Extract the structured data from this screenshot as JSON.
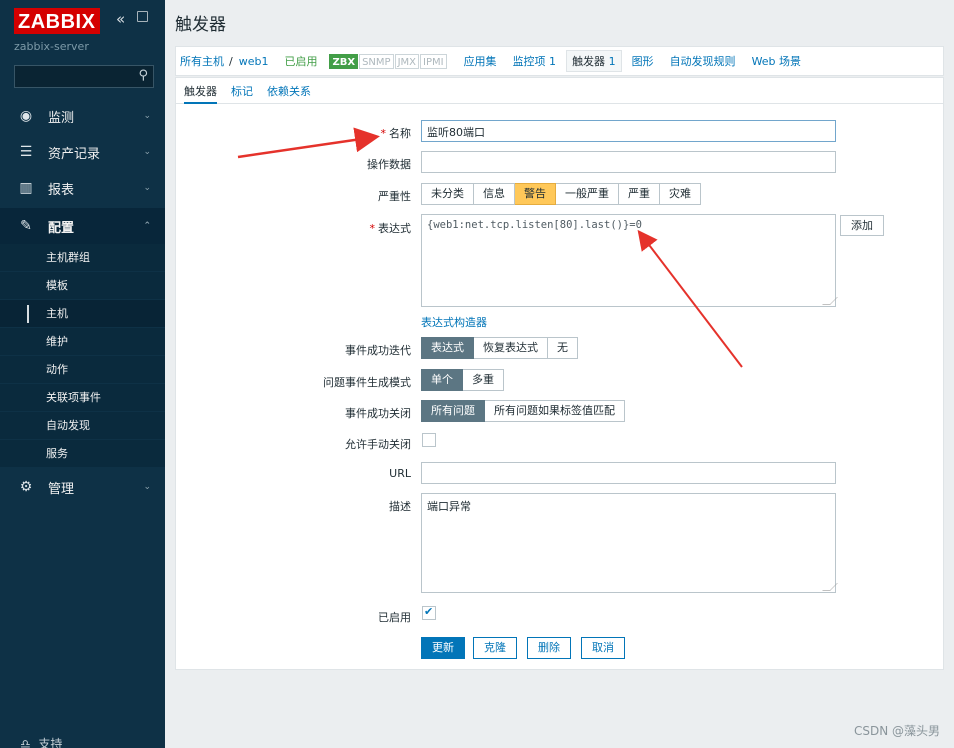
{
  "sidebar": {
    "logo": "ZABBIX",
    "server": "zabbix-server",
    "menu": [
      {
        "label": "监测",
        "icon": "eye-icon"
      },
      {
        "label": "资产记录",
        "icon": "list-icon"
      },
      {
        "label": "报表",
        "icon": "bar-chart-icon"
      },
      {
        "label": "配置",
        "icon": "wrench-icon"
      },
      {
        "label": "管理",
        "icon": "gear-icon"
      }
    ],
    "submenu": [
      "主机群组",
      "模板",
      "主机",
      "维护",
      "动作",
      "关联项事件",
      "自动发现",
      "服务"
    ],
    "support": "支持"
  },
  "page": {
    "title": "触发器"
  },
  "host_nav": {
    "all_hosts": "所有主机",
    "separator": "/",
    "host": "web1",
    "status": "已启用",
    "tags": [
      "ZBX",
      "SNMP",
      "JMX",
      "IPMI"
    ],
    "app": "应用集",
    "items": "监控项 1",
    "triggers_label": "触发器",
    "triggers_count": "1",
    "graphs": "图形",
    "discovery": "自动发现规则",
    "web": "Web 场景"
  },
  "subtabs": [
    "触发器",
    "标记",
    "依赖关系"
  ],
  "form": {
    "name_label": "名称",
    "name_value": "监听80端口",
    "opdata_label": "操作数据",
    "opdata_value": "",
    "severity_label": "严重性",
    "severity_options": [
      "未分类",
      "信息",
      "警告",
      "一般严重",
      "严重",
      "灾难"
    ],
    "severity_selected": "警告",
    "expression_label": "表达式",
    "expression_value": "{web1:net.tcp.listen[80].last()}=0",
    "add_button": "添加",
    "builder_link": "表达式构造器",
    "ok_event_label": "事件成功迭代",
    "ok_event_options": [
      "表达式",
      "恢复表达式",
      "无"
    ],
    "mode_label": "问题事件生成模式",
    "mode_options": [
      "单个",
      "多重"
    ],
    "close_label": "事件成功关闭",
    "close_options": [
      "所有问题",
      "所有问题如果标签值匹配"
    ],
    "manual_close_label": "允许手动关闭",
    "manual_close_checked": false,
    "url_label": "URL",
    "url_value": "",
    "desc_label": "描述",
    "desc_value": "端口异常",
    "enabled_label": "已启用",
    "enabled_checked": true,
    "buttons": {
      "update": "更新",
      "clone": "克隆",
      "delete": "删除",
      "cancel": "取消"
    }
  },
  "watermark": "CSDN @藻头男",
  "colors": {
    "sidebar": "#0e3146",
    "logo": "#d40000",
    "accent": "#0275b8",
    "warn": "#ffc859",
    "arrow": "#e5322b"
  }
}
